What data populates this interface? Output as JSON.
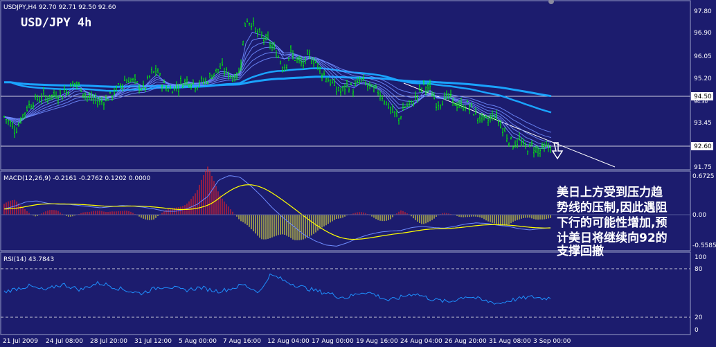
{
  "window": {
    "symbol_line": "USDJPY,H4  92.70 92.71 92.50 92.60",
    "big_title": "USD/JPY 4h"
  },
  "annotation": {
    "lines": [
      "美日上方受到压力趋",
      "势线的压制,因此遇阻",
      "下行的可能性增加,预",
      "计美日将继续向92的",
      "支撑回撤"
    ]
  },
  "colors": {
    "background": "#1c1c6e",
    "candles": "#00ff00",
    "thin_ma": "#6f8cff",
    "thick_ma": "#1aa3ff",
    "macd_up": "#ff2020",
    "macd_down": "#ffff33",
    "signal": "#ffff00",
    "rsi_line": "#1e90ff",
    "text": "#ffffff"
  },
  "price_pane": {
    "price_labels": [
      "97.80",
      "96.90",
      "96.05",
      "95.20",
      "94.50",
      "94.30",
      "93.45",
      "92.60",
      "91.75"
    ],
    "levels": [
      94.5,
      92.6
    ],
    "current_price": "92.60",
    "hline_label": "94.50"
  },
  "macd_pane": {
    "title": "MACD(12,26,9) -0.2161 -0.2762 0.1202 0.0000",
    "labels": [
      "0.6725",
      "0.00",
      "-0.5585"
    ]
  },
  "rsi_pane": {
    "title": "RSI(14) 43.7843",
    "labels": [
      "100",
      "80",
      "20",
      "0"
    ]
  },
  "time_axis": {
    "labels": [
      "21 Jul 2009",
      "24 Jul 08:00",
      "28 Jul 20:00",
      "31 Jul 12:00",
      "5 Aug 00:00",
      "7 Aug 16:00",
      "12 Aug 04:00",
      "17 Aug 00:00",
      "19 Aug 16:00",
      "24 Aug 04:00",
      "26 Aug 20:00",
      "31 Aug 08:00",
      "3 Sep 00:00"
    ]
  },
  "chart_data": {
    "type": "line",
    "title": "USD/JPY 4h",
    "ylim": [
      91.75,
      98.1
    ],
    "price_series": [
      93.8,
      93.5,
      93.3,
      93.9,
      94.3,
      94.5,
      94.6,
      94.6,
      94.7,
      94.7,
      94.9,
      95.2,
      95.0,
      94.6,
      94.5,
      94.4,
      94.5,
      94.7,
      95.0,
      95.3,
      95.3,
      95.1,
      94.9,
      95.5,
      95.7,
      95.1,
      94.9,
      95.0,
      95.2,
      95.3,
      95.1,
      95.2,
      95.3,
      95.6,
      95.8,
      95.6,
      95.4,
      95.6,
      97.8,
      97.6,
      97.1,
      97.0,
      96.7,
      96.3,
      95.8,
      96.4,
      96.1,
      95.9,
      96.3,
      96.0,
      95.6,
      95.3,
      95.0,
      94.8,
      95.1,
      94.9,
      95.3,
      95.1,
      94.9,
      94.8,
      94.4,
      94.0,
      93.7,
      94.2,
      94.3,
      94.7,
      95.1,
      94.9,
      94.3,
      94.5,
      94.6,
      94.3,
      94.2,
      94.3,
      93.9,
      93.7,
      93.6,
      93.9,
      93.5,
      93.0,
      92.7,
      92.8,
      92.5,
      92.6,
      92.4,
      92.5,
      92.6
    ],
    "series": [
      {
        "name": "MACD(12,26,9)",
        "values": [
          0.1,
          0.15,
          0.22,
          0.24,
          0.2,
          0.18,
          0.18,
          0.16,
          0.14,
          0.12,
          0.14,
          0.16,
          0.15,
          0.13,
          0.1,
          0.06,
          0.06,
          0.1,
          0.18,
          0.32,
          0.6,
          0.68,
          0.65,
          0.5,
          0.32,
          0.12,
          -0.05,
          -0.2,
          -0.35,
          -0.45,
          -0.52,
          -0.54,
          -0.48,
          -0.4,
          -0.34,
          -0.3,
          -0.28,
          -0.27,
          -0.22,
          -0.2,
          -0.22,
          -0.23,
          -0.2,
          -0.16,
          -0.14,
          -0.15,
          -0.18,
          -0.2,
          -0.24,
          -0.26,
          -0.24,
          -0.22
        ]
      },
      {
        "name": "RSI(14)",
        "values": [
          52,
          55,
          58,
          60,
          56,
          54,
          60,
          62,
          58,
          55,
          60,
          64,
          62,
          58,
          55,
          52,
          50,
          54,
          58,
          60,
          57,
          54,
          56,
          58,
          55,
          53,
          55,
          58,
          62,
          56,
          52,
          75,
          72,
          66,
          62,
          58,
          55,
          52,
          50,
          46,
          44,
          48,
          52,
          50,
          45,
          40,
          43,
          47,
          50,
          46,
          42,
          40,
          38,
          42,
          46,
          44,
          40,
          38,
          36,
          40,
          42,
          44,
          45,
          43,
          44
        ]
      }
    ]
  }
}
